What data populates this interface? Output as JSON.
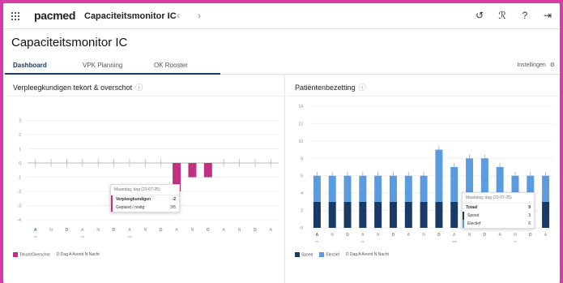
{
  "topbar": {
    "brand": "pacmed",
    "app_title": "Capaciteitsmonitor IC",
    "back_arrow": "‹",
    "forward_arrow": "›",
    "icons": [
      "history-icon",
      "user-settings-icon",
      "help-icon",
      "logout-icon"
    ],
    "icon_glyphs": [
      "↺",
      "ℛ",
      "?",
      "⇥"
    ]
  },
  "page_title": "Capaciteitsmonitor IC",
  "tabs": [
    {
      "label": "Dashboard",
      "active": true
    },
    {
      "label": "VPK Planning",
      "active": false
    },
    {
      "label": "OK Rooster",
      "active": false
    }
  ],
  "settings_label": "Instellingen",
  "left_panel": {
    "title": "Verpleegkundigen tekort & overschot",
    "info_icon": "ⓘ",
    "legend": {
      "series_label": "Tekort/Overschot",
      "shift_letters": "D Dag   A Avond   N Nacht"
    },
    "tooltip": {
      "header": "Maandag, dag (23-07-25)",
      "row1_label": "Verpleegkundigen",
      "row1_value": "-2",
      "row2_label": "Gepland / nodig",
      "row2_value": "3/5"
    }
  },
  "right_panel": {
    "title": "Patiëntenbezetting",
    "info_icon": "ⓘ",
    "legend": {
      "series1": "Spoed",
      "series2": "Electief",
      "shift_letters": "D Dag   A Avond   N Nacht"
    },
    "tooltip": {
      "header": "Maandag, dag (23-07-25)",
      "row1_label": "Totaal",
      "row1_value": "9",
      "row2_label": "Spoed",
      "row2_value": "3",
      "row3_label": "Electief",
      "row3_value": "6"
    }
  },
  "colors": {
    "accent": "#1b3a6b",
    "deficit": "#c2317f",
    "spoed": "#173a66",
    "electief": "#5b9be0",
    "frame": "#d63ba6"
  },
  "chart_data": [
    {
      "type": "bar",
      "title": "Verpleegkundigen tekort & overschot",
      "ylim": [
        -4,
        4
      ],
      "yticks": [
        3,
        2,
        1,
        0,
        -1,
        -2,
        -3,
        -4
      ],
      "categories": [
        "A",
        "N",
        "D",
        "A",
        "N",
        "D",
        "A",
        "N",
        "D",
        "A",
        "N",
        "D",
        "A",
        "N",
        "D",
        "A"
      ],
      "day_labels": [
        "ze",
        "",
        "",
        "zo",
        "",
        "",
        "ma",
        "",
        "",
        "",
        "",
        "",
        "",
        "",
        "",
        ""
      ],
      "values": [
        0,
        0,
        0,
        0,
        0,
        0,
        0,
        0,
        0,
        -2,
        -1,
        -1,
        0,
        0,
        0,
        0
      ],
      "series": [
        {
          "name": "Tekort/Overschot",
          "values": [
            0,
            0,
            0,
            0,
            0,
            0,
            0,
            0,
            0,
            -2,
            -1,
            -1,
            0,
            0,
            0,
            0
          ]
        }
      ],
      "grid": true
    },
    {
      "type": "bar",
      "title": "Patiëntenbezetting",
      "ylim": [
        0,
        14
      ],
      "yticks": [
        14,
        12,
        10,
        8,
        6,
        4,
        2,
        0
      ],
      "categories": [
        "A",
        "N",
        "D",
        "A",
        "N",
        "D",
        "A",
        "N",
        "D",
        "A",
        "N",
        "D",
        "A",
        "N",
        "D",
        "A"
      ],
      "day_labels": [
        "ze",
        "",
        "",
        "zo",
        "",
        "",
        "",
        "",
        "",
        "ma",
        "",
        "",
        "",
        "di",
        "",
        ""
      ],
      "series": [
        {
          "name": "Spoed",
          "values": [
            3,
            3,
            3,
            3,
            3,
            3,
            3,
            3,
            3,
            3,
            3,
            3,
            3,
            3,
            3,
            3
          ]
        },
        {
          "name": "Electief",
          "values": [
            3,
            3,
            3,
            3,
            3,
            3,
            3,
            3,
            6,
            4,
            5,
            5,
            4,
            3,
            3,
            3
          ]
        }
      ],
      "grid": true
    }
  ]
}
